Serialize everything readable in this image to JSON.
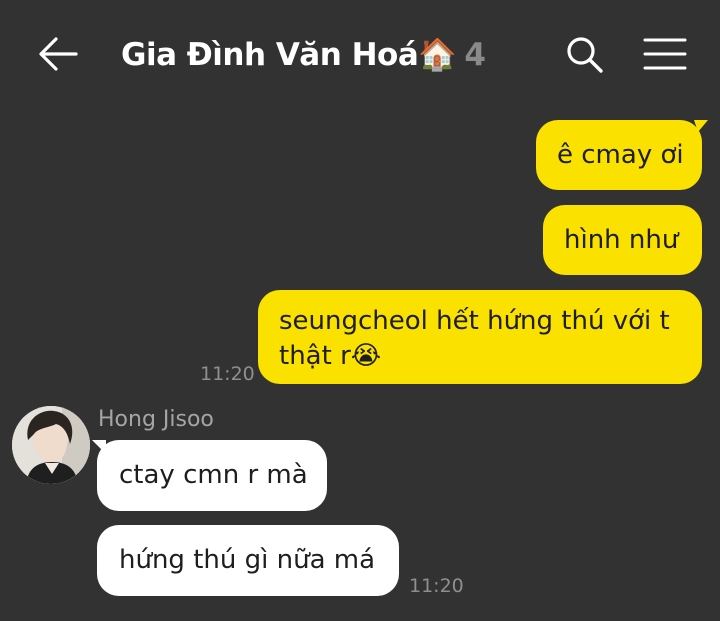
{
  "header": {
    "title": "Gia Đình Văn Hoá",
    "title_emoji": "🏠",
    "member_count": "4",
    "back_icon": "arrow-left-icon",
    "search_icon": "search-icon",
    "menu_icon": "hamburger-menu-icon"
  },
  "colors": {
    "background": "#323232",
    "outgoing_bubble": "#fae100",
    "incoming_bubble": "#ffffff",
    "time_text": "#8f8f8f"
  },
  "messages": {
    "out_1": "ê cmay ơi",
    "out_2": "hình như",
    "out_3_line1": "seungcheol hết hứng thú với t",
    "out_3_line2": "thật r",
    "out_3_emoji": "😭",
    "out_time": "11:20",
    "sender_name": "Hong Jisoo",
    "in_1": "ctay cmn r mà",
    "in_2": "hứng thú gì nữa má",
    "in_time": "11:20"
  }
}
